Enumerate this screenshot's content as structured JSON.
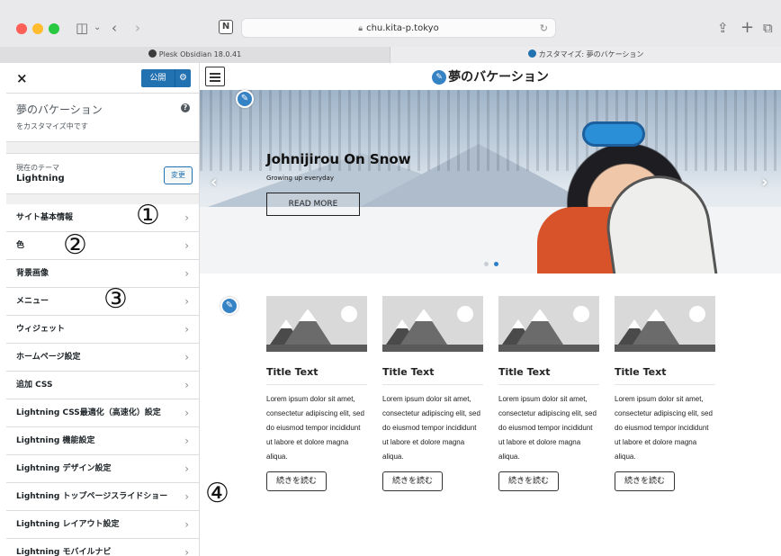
{
  "browser": {
    "url": "chu.kita-p.tokyo",
    "tabs": [
      {
        "label": "Plesk Obsidian 18.0.41",
        "icon_color": "#3b3b3b"
      },
      {
        "label": "カスタマイズ: 夢のバケーション",
        "icon_color": "#2271b1"
      }
    ]
  },
  "customizer": {
    "close_glyph": "×",
    "publish_label": "公開",
    "site_name": "夢のバケーション",
    "subtitle": "をカスタマイズ中です",
    "theme_label": "現在のテーマ",
    "theme_name": "Lightning",
    "change_label": "変更",
    "menu": [
      {
        "label": "サイト基本情報"
      },
      {
        "label": "色"
      },
      {
        "label": "背景画像"
      },
      {
        "label": "メニュー"
      },
      {
        "label": "ウィジェット"
      },
      {
        "label": "ホームページ設定"
      },
      {
        "label": "追加 CSS"
      },
      {
        "label": "Lightning CSS最適化（高速化）設定"
      },
      {
        "label": "Lightning 機能設定"
      },
      {
        "label": "Lightning デザイン設定"
      },
      {
        "label": "Lightning トップページスライドショー"
      },
      {
        "label": "Lightning レイアウト設定"
      },
      {
        "label": "Lightning モバイルナビ"
      }
    ],
    "accent_color": "#2271b1"
  },
  "annotations": [
    "①",
    "②",
    "③",
    "④"
  ],
  "preview": {
    "site_title": "夢のバケーション",
    "hero": {
      "title": "Johnijirou On Snow",
      "subtitle": "Growing up everyday",
      "button": "READ MORE"
    },
    "cards": [
      {
        "title": "Title Text",
        "text": "Lorem ipsum dolor sit amet, consectetur adipiscing elit, sed do eiusmod tempor incididunt ut labore et dolore magna aliqua.",
        "button": "続きを読む"
      },
      {
        "title": "Title Text",
        "text": "Lorem ipsum dolor sit amet, consectetur adipiscing elit, sed do eiusmod tempor incididunt ut labore et dolore magna aliqua.",
        "button": "続きを読む"
      },
      {
        "title": "Title Text",
        "text": "Lorem ipsum dolor sit amet, consectetur adipiscing elit, sed do eiusmod tempor incididunt ut labore et dolore magna aliqua.",
        "button": "続きを読む"
      },
      {
        "title": "Title Text",
        "text": "Lorem ipsum dolor sit amet, consectetur adipiscing elit, sed do eiusmod tempor incididunt ut labore et dolore magna aliqua.",
        "button": "続きを読む"
      }
    ]
  }
}
